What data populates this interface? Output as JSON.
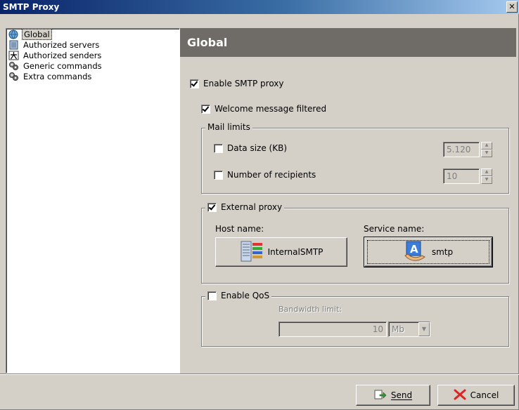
{
  "window": {
    "title": "SMTP Proxy",
    "close_glyph": "✕"
  },
  "tree": {
    "items": [
      {
        "label": "Global",
        "icon": "globe-icon",
        "selected": true
      },
      {
        "label": "Authorized servers",
        "icon": "server-icon"
      },
      {
        "label": "Authorized senders",
        "icon": "people-icon"
      },
      {
        "label": "Generic commands",
        "icon": "gear-cluster-icon"
      },
      {
        "label": "Extra commands",
        "icon": "gear-cluster-icon"
      }
    ]
  },
  "panel": {
    "title": "Global",
    "enable_smtp_proxy": {
      "label": "Enable SMTP proxy",
      "checked": true
    },
    "welcome_filtered": {
      "label": "Welcome message filtered",
      "checked": true
    },
    "mail_limits": {
      "legend": "Mail limits",
      "data_size": {
        "label": "Data size (KB)",
        "checked": false,
        "value": "5.120"
      },
      "recipients": {
        "label": "Number of recipients",
        "checked": false,
        "value": "10"
      }
    },
    "external_proxy": {
      "legend": "External proxy",
      "checked": true,
      "host_label": "Host name:",
      "host_value": "InternalSMTP",
      "service_label": "Service name:",
      "service_value": "smtp"
    },
    "qos": {
      "legend": "Enable QoS",
      "checked": false,
      "bandwidth_label": "Bandwidth limit:",
      "bandwidth_value": "10",
      "unit": "Mb"
    }
  },
  "footer": {
    "send_label": "Send",
    "cancel_label": "Cancel"
  },
  "colors": {
    "title_bar": "#0a246a",
    "panel_header": "#6f6b66",
    "face": "#d4d0c8"
  }
}
